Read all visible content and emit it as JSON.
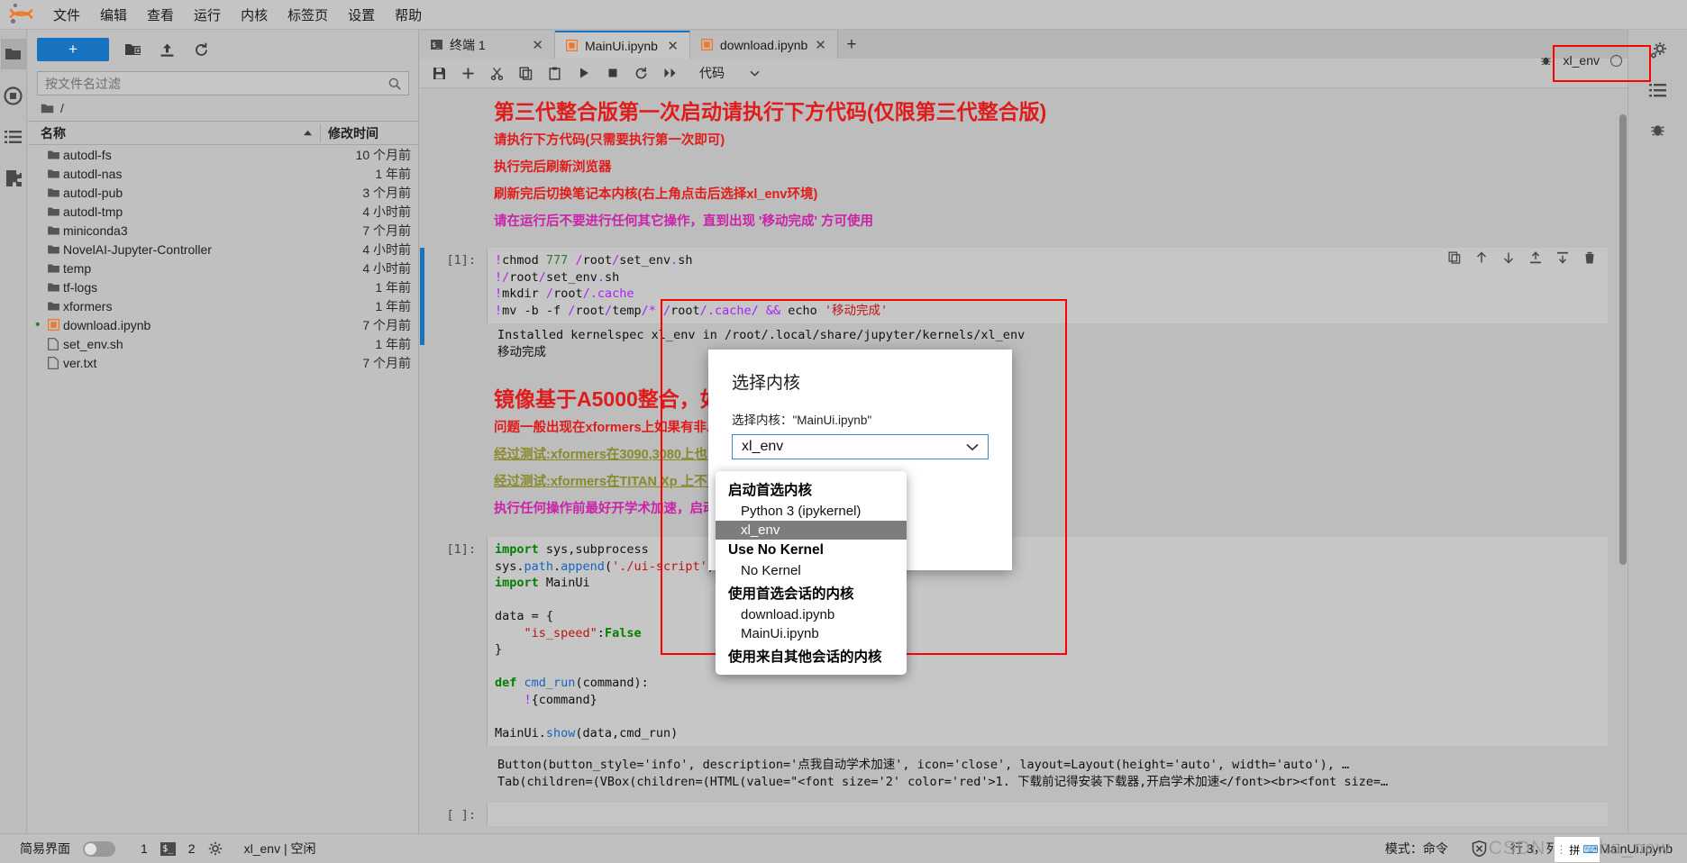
{
  "app": {
    "logo_icon": "jupyter-logo-icon"
  },
  "menubar": {
    "items": [
      {
        "label": "文件"
      },
      {
        "label": "编辑"
      },
      {
        "label": "查看"
      },
      {
        "label": "运行"
      },
      {
        "label": "内核"
      },
      {
        "label": "标签页"
      },
      {
        "label": "设置"
      },
      {
        "label": "帮助"
      }
    ]
  },
  "left_rail": {
    "items": [
      {
        "name": "folder-icon",
        "label": "文件浏览器"
      },
      {
        "name": "stop-circle-icon",
        "label": "运行中的终端和内核"
      },
      {
        "name": "list-icon",
        "label": "目录"
      },
      {
        "name": "puzzle-icon",
        "label": "扩展管理器"
      }
    ]
  },
  "filebrowser": {
    "new_button_label": "+",
    "toolbar_icons": [
      "new-folder-icon",
      "upload-icon",
      "refresh-icon"
    ],
    "filter_placeholder": "按文件名过滤",
    "filter_value": "",
    "search_icon": "search-icon",
    "breadcrumb": "/",
    "columns": {
      "name": "名称",
      "modified": "修改时间"
    },
    "sort_indicator": "caret-up-icon",
    "rows": [
      {
        "name": "autodl-fs",
        "modified": "10 个月前",
        "type": "folder",
        "running": false
      },
      {
        "name": "autodl-nas",
        "modified": "1 年前",
        "type": "folder",
        "running": false
      },
      {
        "name": "autodl-pub",
        "modified": "3 个月前",
        "type": "folder",
        "running": false
      },
      {
        "name": "autodl-tmp",
        "modified": "4 小时前",
        "type": "folder",
        "running": false
      },
      {
        "name": "miniconda3",
        "modified": "7 个月前",
        "type": "folder",
        "running": false
      },
      {
        "name": "NovelAI-Jupyter-Controller",
        "modified": "4 小时前",
        "type": "folder",
        "running": false
      },
      {
        "name": "temp",
        "modified": "4 小时前",
        "type": "folder",
        "running": false
      },
      {
        "name": "tf-logs",
        "modified": "1 年前",
        "type": "folder",
        "running": false
      },
      {
        "name": "xformers",
        "modified": "1 年前",
        "type": "folder",
        "running": false
      },
      {
        "name": "download.ipynb",
        "modified": "7 个月前",
        "type": "notebook",
        "running": true
      },
      {
        "name": "set_env.sh",
        "modified": "1 年前",
        "type": "file",
        "running": false
      },
      {
        "name": "ver.txt",
        "modified": "7 个月前",
        "type": "file",
        "running": false
      }
    ]
  },
  "tabs": [
    {
      "label": "终端 1",
      "icon": "terminal-icon",
      "active": false,
      "close_icon": "close-icon"
    },
    {
      "label": "MainUi.ipynb",
      "icon": "notebook-icon",
      "active": true,
      "close_icon": "close-icon"
    },
    {
      "label": "download.ipynb",
      "icon": "notebook-icon",
      "active": false,
      "close_icon": "close-icon"
    }
  ],
  "tab_add_label": "+",
  "notebook_toolbar": {
    "icons": [
      "save-icon",
      "add-cell-icon",
      "cut-icon",
      "copy-icon",
      "paste-icon",
      "run-icon",
      "stop-icon",
      "restart-icon",
      "restart-run-all-icon"
    ],
    "celltype_value": "代码",
    "celltype_caret": "chevron-down-icon"
  },
  "kernel_indicator": {
    "bug_icon": "debug-icon",
    "kernel_name": "xl_env",
    "status_icon": "kernel-idle-circle-icon"
  },
  "right_rail": {
    "items": [
      {
        "name": "settings-gear-icon"
      },
      {
        "name": "property-inspector-icon"
      },
      {
        "name": "debugger-icon"
      }
    ]
  },
  "notebook": {
    "markdown_1": {
      "heading": "第三代整合版第一次启动请执行下方代码(仅限第三代整合版)",
      "lines": [
        {
          "text": "请执行下方代码(只需要执行第一次即可)",
          "color": "red"
        },
        {
          "text": "执行完后刷新浏览器",
          "color": "red"
        },
        {
          "text": "刷新完后切换笔记本内核(右上角点击后选择xl_env环境)",
          "color": "red"
        },
        {
          "text": "请在运行后不要进行任何其它操作，直到出现 '移动完成' 方可使用",
          "color": "magenta"
        }
      ]
    },
    "cell_1": {
      "prompt": "[1]:",
      "source_lines": [
        "!chmod 777 /root/set_env.sh",
        "!/root/set_env.sh",
        "!mkdir /root/.cache",
        "!mv -b -f /root/temp/* /root/.cache/ && echo '移动完成'"
      ],
      "output_lines": [
        "Installed kernelspec xl_env in /root/.local/share/jupyter/kernels/xl_env",
        "移动完成"
      ]
    },
    "markdown_2": {
      "heading": "镜像基于A5000整合，如出现任何问题请换A5000尝试",
      "lines": [
        {
          "text": "问题一般出现在xformers上如果有非A5000卡",
          "color": "red"
        },
        {
          "text": "经过测试:xformers在3090,3080上也可以使用",
          "color": "olive"
        },
        {
          "text": "经过测试:xformers在TITAN Xp 上不可使用",
          "color": "olive"
        },
        {
          "text": "执行任何操作前最好开学术加速，启动后会有新东西出现✨",
          "color": "magenta"
        }
      ]
    },
    "cell_2": {
      "prompt": "[1]:",
      "source_lines": [
        "import sys,subprocess",
        "sys.path.append('./ui-script')",
        "import MainUi",
        "",
        "data = {",
        "    \"is_speed\":False",
        "}",
        "",
        "def cmd_run(command):",
        "    !{command}",
        "",
        "MainUi.show(data,cmd_run)"
      ],
      "output_lines": [
        "Button(button_style='info', description='点我自动学术加速', icon='close', layout=Layout(height='auto', width='auto'), …",
        "Tab(children=(VBox(children=(HTML(value=\"<font size='2' color='red'>1. 下载前记得安装下载器,开启学术加速</font><br><font size=…"
      ]
    },
    "cell_3": {
      "prompt": "[ ]:",
      "source_lines": [
        ""
      ]
    }
  },
  "kernel_dialog": {
    "title": "选择内核",
    "label": "选择内核：\"MainUi.ipynb\"",
    "selected_value": "xl_env",
    "caret_icon": "chevron-down-icon",
    "dropdown": [
      {
        "type": "group",
        "label": "启动首选内核"
      },
      {
        "type": "item",
        "label": "Python 3 (ipykernel)",
        "selected": false
      },
      {
        "type": "item",
        "label": "xl_env",
        "selected": true
      },
      {
        "type": "group",
        "label": "Use No Kernel"
      },
      {
        "type": "item",
        "label": "No Kernel",
        "selected": false
      },
      {
        "type": "group",
        "label": "使用首选会话的内核"
      },
      {
        "type": "item",
        "label": "download.ipynb",
        "selected": false
      },
      {
        "type": "item",
        "label": "MainUi.ipynb",
        "selected": false
      },
      {
        "type": "group",
        "label": "使用来自其他会话的内核"
      }
    ]
  },
  "statusbar": {
    "simple_label": "简易界面",
    "toggle_on": false,
    "terminal_count": "1",
    "terminal_icon": "terminal-icon",
    "kernel_count": "2",
    "kernel_icon": "gear-kernel-icon",
    "kernel_status": "xl_env | 空闲",
    "mode": "模式：命令",
    "shield_icon": "no-connection-shield-icon",
    "position": "行 3，列 20",
    "filename": "MainUi.ipynb",
    "watermark": "CSDN @msha_new",
    "ime_pin": "拼"
  },
  "colors": {
    "accent": "#1873c0",
    "red_text": "#e01b1b",
    "magenta_text": "#cc22aa",
    "olive_text": "#8a8a2a",
    "annotation": "#ff0000",
    "chrome": "#bdbdbd"
  }
}
